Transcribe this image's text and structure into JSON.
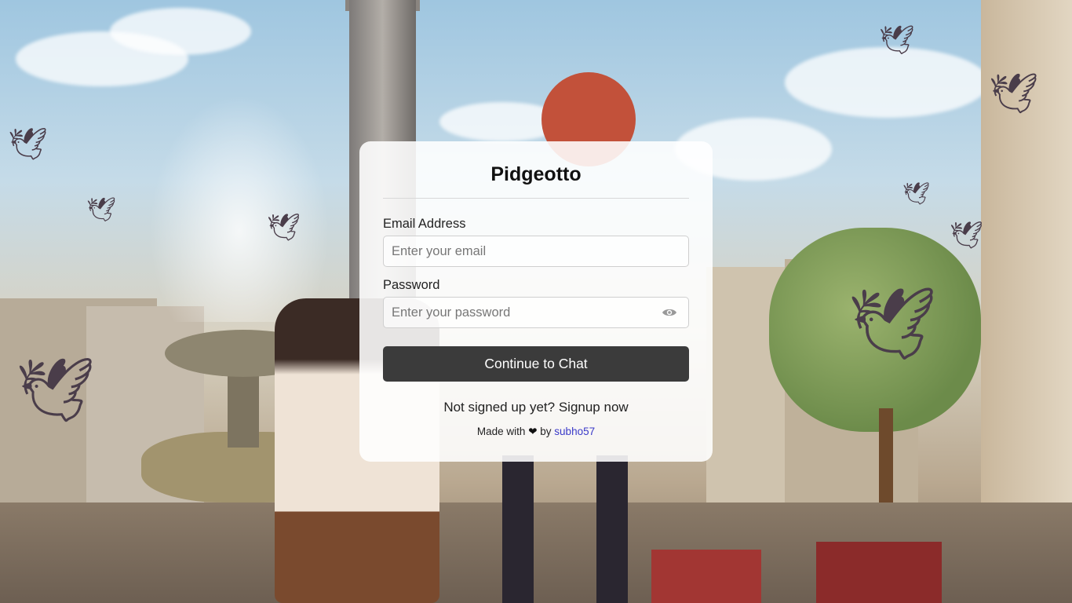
{
  "app": {
    "title": "Pidgeotto"
  },
  "form": {
    "email_label": "Email Address",
    "email_placeholder": "Enter your email",
    "email_value": "",
    "password_label": "Password",
    "password_placeholder": "Enter your password",
    "password_value": "",
    "toggle_visibility_icon": "eye-icon",
    "submit_label": "Continue to Chat"
  },
  "signup": {
    "prompt": "Not signed up yet?",
    "link_label": "Signup now"
  },
  "footer": {
    "made_with": "Made with",
    "heart": "❤",
    "by": "by",
    "author": "subho57"
  },
  "colors": {
    "button_bg": "#3b3b3b",
    "author_link": "#3a3ac8"
  }
}
